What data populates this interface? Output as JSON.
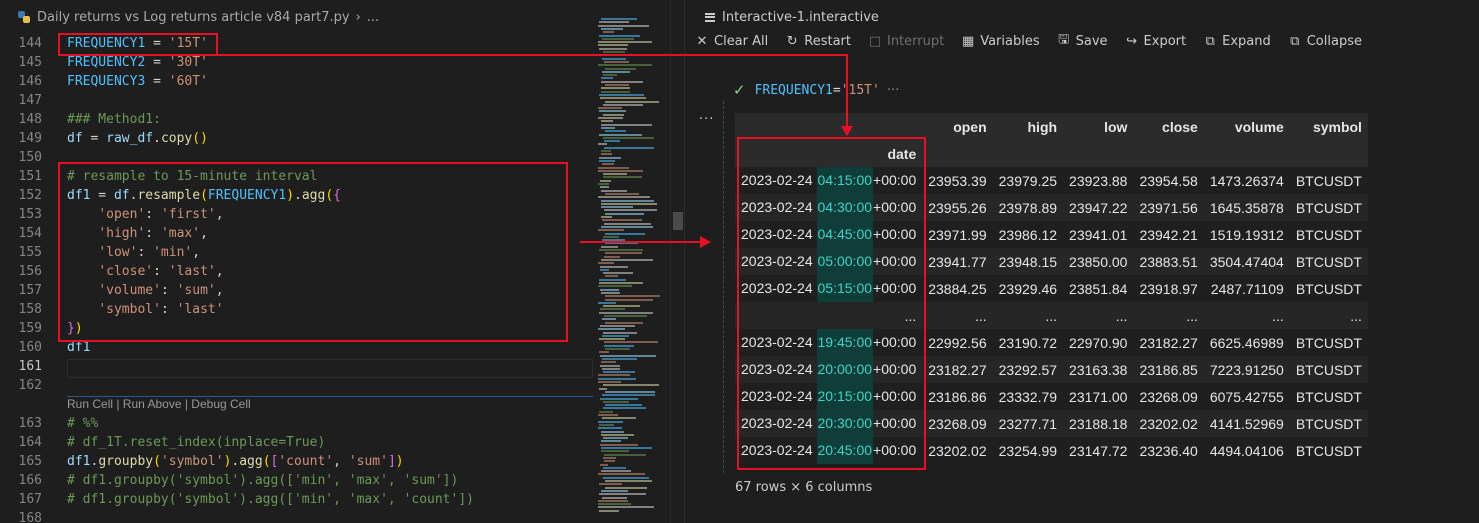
{
  "editor": {
    "breadcrumb": [
      "Daily returns vs Log returns article v84 part7.py",
      "..."
    ],
    "lines": [
      {
        "num": "144",
        "tokens": [
          [
            "v",
            "FREQUENCY1"
          ],
          [
            "o",
            " = "
          ],
          [
            "s",
            "'15T'"
          ]
        ]
      },
      {
        "num": "145",
        "tokens": [
          [
            "v",
            "FREQUENCY2"
          ],
          [
            "o",
            " = "
          ],
          [
            "s",
            "'30T'"
          ]
        ]
      },
      {
        "num": "146",
        "tokens": [
          [
            "v",
            "FREQUENCY3"
          ],
          [
            "o",
            " = "
          ],
          [
            "s",
            "'60T'"
          ]
        ]
      },
      {
        "num": "147",
        "tokens": []
      },
      {
        "num": "148",
        "tokens": [
          [
            "c",
            "### Method1:"
          ]
        ]
      },
      {
        "num": "149",
        "tokens": [
          [
            "vb",
            "df"
          ],
          [
            "o",
            " = "
          ],
          [
            "vb",
            "raw_df"
          ],
          [
            "o",
            "."
          ],
          [
            "f",
            "copy"
          ],
          [
            "b1",
            "()"
          ]
        ]
      },
      {
        "num": "150",
        "tokens": []
      },
      {
        "num": "151",
        "tokens": [
          [
            "c",
            "# resample to 15-minute interval"
          ]
        ]
      },
      {
        "num": "152",
        "tokens": [
          [
            "vb",
            "df1"
          ],
          [
            "o",
            " = "
          ],
          [
            "vb",
            "df"
          ],
          [
            "o",
            "."
          ],
          [
            "f",
            "resample"
          ],
          [
            "b1",
            "("
          ],
          [
            "v",
            "FREQUENCY1"
          ],
          [
            "b1",
            ")"
          ],
          [
            "o",
            "."
          ],
          [
            "f",
            "agg"
          ],
          [
            "b1",
            "("
          ],
          [
            "b2",
            "{"
          ]
        ]
      },
      {
        "num": "153",
        "tokens": [
          [
            "o",
            "    "
          ],
          [
            "s",
            "'open'"
          ],
          [
            "o",
            ": "
          ],
          [
            "s",
            "'first'"
          ],
          [
            "o",
            ","
          ]
        ]
      },
      {
        "num": "154",
        "tokens": [
          [
            "o",
            "    "
          ],
          [
            "s",
            "'high'"
          ],
          [
            "o",
            ": "
          ],
          [
            "s",
            "'max'"
          ],
          [
            "o",
            ","
          ]
        ]
      },
      {
        "num": "155",
        "tokens": [
          [
            "o",
            "    "
          ],
          [
            "s",
            "'low'"
          ],
          [
            "o",
            ": "
          ],
          [
            "s",
            "'min'"
          ],
          [
            "o",
            ","
          ]
        ]
      },
      {
        "num": "156",
        "tokens": [
          [
            "o",
            "    "
          ],
          [
            "s",
            "'close'"
          ],
          [
            "o",
            ": "
          ],
          [
            "s",
            "'last'"
          ],
          [
            "o",
            ","
          ]
        ]
      },
      {
        "num": "157",
        "tokens": [
          [
            "o",
            "    "
          ],
          [
            "s",
            "'volume'"
          ],
          [
            "o",
            ": "
          ],
          [
            "s",
            "'sum'"
          ],
          [
            "o",
            ","
          ]
        ]
      },
      {
        "num": "158",
        "tokens": [
          [
            "o",
            "    "
          ],
          [
            "s",
            "'symbol'"
          ],
          [
            "o",
            ": "
          ],
          [
            "s",
            "'last'"
          ]
        ]
      },
      {
        "num": "159",
        "tokens": [
          [
            "b2",
            "}"
          ],
          [
            "b1",
            ")"
          ]
        ]
      },
      {
        "num": "160",
        "tokens": [
          [
            "vb",
            "df1"
          ]
        ]
      },
      {
        "num": "161",
        "tokens": [],
        "active": true
      },
      {
        "num": "162",
        "tokens": []
      },
      {
        "codelens": "Run Cell | Run Above | Debug Cell"
      },
      {
        "num": "163",
        "tokens": [
          [
            "c",
            "# %%"
          ]
        ]
      },
      {
        "num": "164",
        "tokens": [
          [
            "c",
            "# df_1T.reset_index(inplace=True)"
          ]
        ]
      },
      {
        "num": "165",
        "tokens": [
          [
            "vb",
            "df1"
          ],
          [
            "o",
            "."
          ],
          [
            "f",
            "groupby"
          ],
          [
            "b1",
            "("
          ],
          [
            "s",
            "'symbol'"
          ],
          [
            "b1",
            ")"
          ],
          [
            "o",
            "."
          ],
          [
            "f",
            "agg"
          ],
          [
            "b1",
            "("
          ],
          [
            "b2",
            "["
          ],
          [
            "s",
            "'count'"
          ],
          [
            "o",
            ", "
          ],
          [
            "s",
            "'sum'"
          ],
          [
            "b2",
            "]"
          ],
          [
            "b1",
            ")"
          ]
        ]
      },
      {
        "num": "166",
        "tokens": [
          [
            "c",
            "# df1.groupby('symbol').agg(['min', 'max', 'sum'])"
          ]
        ]
      },
      {
        "num": "167",
        "tokens": [
          [
            "c",
            "# df1.groupby('symbol').agg(['min', 'max', 'count'])"
          ]
        ]
      },
      {
        "num": "168",
        "tokens": []
      }
    ]
  },
  "interactive": {
    "tab_title": "Interactive-1.interactive",
    "toolbar": [
      {
        "name": "clear-all",
        "icon": "✕",
        "label": "Clear All",
        "disabled": false
      },
      {
        "name": "restart",
        "icon": "↻",
        "label": "Restart",
        "disabled": false
      },
      {
        "name": "interrupt",
        "icon": "□",
        "label": "Interrupt",
        "disabled": true
      },
      {
        "name": "variables",
        "icon": "▦",
        "label": "Variables",
        "disabled": false
      },
      {
        "name": "save",
        "icon": "🖫",
        "label": "Save",
        "disabled": false
      },
      {
        "name": "export",
        "icon": "↪",
        "label": "Export",
        "disabled": false
      },
      {
        "name": "expand",
        "icon": "⧉",
        "label": "Expand",
        "disabled": false
      },
      {
        "name": "collapse",
        "icon": "⧉",
        "label": "Collapse",
        "disabled": false
      }
    ],
    "cell_code_var": "FREQUENCY1",
    "cell_code_rest": " = ",
    "cell_code_str": "'15T'",
    "cell_more": "···",
    "output_more": "···",
    "table": {
      "columns": [
        "open",
        "high",
        "low",
        "close",
        "volume",
        "symbol"
      ],
      "index_name": "date",
      "rows": [
        {
          "date": "2023-02-24",
          "time": "04:15:00",
          "tz": "+00:00",
          "values": [
            "23953.39",
            "23979.25",
            "23923.88",
            "23954.58",
            "1473.26374",
            "BTCUSDT"
          ]
        },
        {
          "date": "2023-02-24",
          "time": "04:30:00",
          "tz": "+00:00",
          "values": [
            "23955.26",
            "23978.89",
            "23947.22",
            "23971.56",
            "1645.35878",
            "BTCUSDT"
          ]
        },
        {
          "date": "2023-02-24",
          "time": "04:45:00",
          "tz": "+00:00",
          "values": [
            "23971.99",
            "23986.12",
            "23941.01",
            "23942.21",
            "1519.19312",
            "BTCUSDT"
          ]
        },
        {
          "date": "2023-02-24",
          "time": "05:00:00",
          "tz": "+00:00",
          "values": [
            "23941.77",
            "23948.15",
            "23850.00",
            "23883.51",
            "3504.47404",
            "BTCUSDT"
          ]
        },
        {
          "date": "2023-02-24",
          "time": "05:15:00",
          "tz": "+00:00",
          "values": [
            "23884.25",
            "23929.46",
            "23851.84",
            "23918.97",
            "2487.71109",
            "BTCUSDT"
          ]
        },
        {
          "ellipsis": true,
          "index": "...",
          "values": [
            "...",
            "...",
            "...",
            "...",
            "...",
            "..."
          ]
        },
        {
          "date": "2023-02-24",
          "time": "19:45:00",
          "tz": "+00:00",
          "values": [
            "22992.56",
            "23190.72",
            "22970.90",
            "23182.27",
            "6625.46989",
            "BTCUSDT"
          ]
        },
        {
          "date": "2023-02-24",
          "time": "20:00:00",
          "tz": "+00:00",
          "values": [
            "23182.27",
            "23292.57",
            "23163.38",
            "23186.85",
            "7223.91250",
            "BTCUSDT"
          ]
        },
        {
          "date": "2023-02-24",
          "time": "20:15:00",
          "tz": "+00:00",
          "values": [
            "23186.86",
            "23332.79",
            "23171.00",
            "23268.09",
            "6075.42755",
            "BTCUSDT"
          ]
        },
        {
          "date": "2023-02-24",
          "time": "20:30:00",
          "tz": "+00:00",
          "values": [
            "23268.09",
            "23277.71",
            "23188.18",
            "23202.02",
            "4141.52969",
            "BTCUSDT"
          ]
        },
        {
          "date": "2023-02-24",
          "time": "20:45:00",
          "tz": "+00:00",
          "values": [
            "23202.02",
            "23254.99",
            "23147.72",
            "23236.40",
            "4494.04106",
            "BTCUSDT"
          ]
        }
      ],
      "shape": "67 rows × 6 columns"
    }
  },
  "colors": {
    "annotation": "#e81123",
    "editor_bg": "#1e1e1e",
    "time_highlight_bg": "#0f3d3a",
    "time_highlight_fg": "#3fd4c7"
  }
}
